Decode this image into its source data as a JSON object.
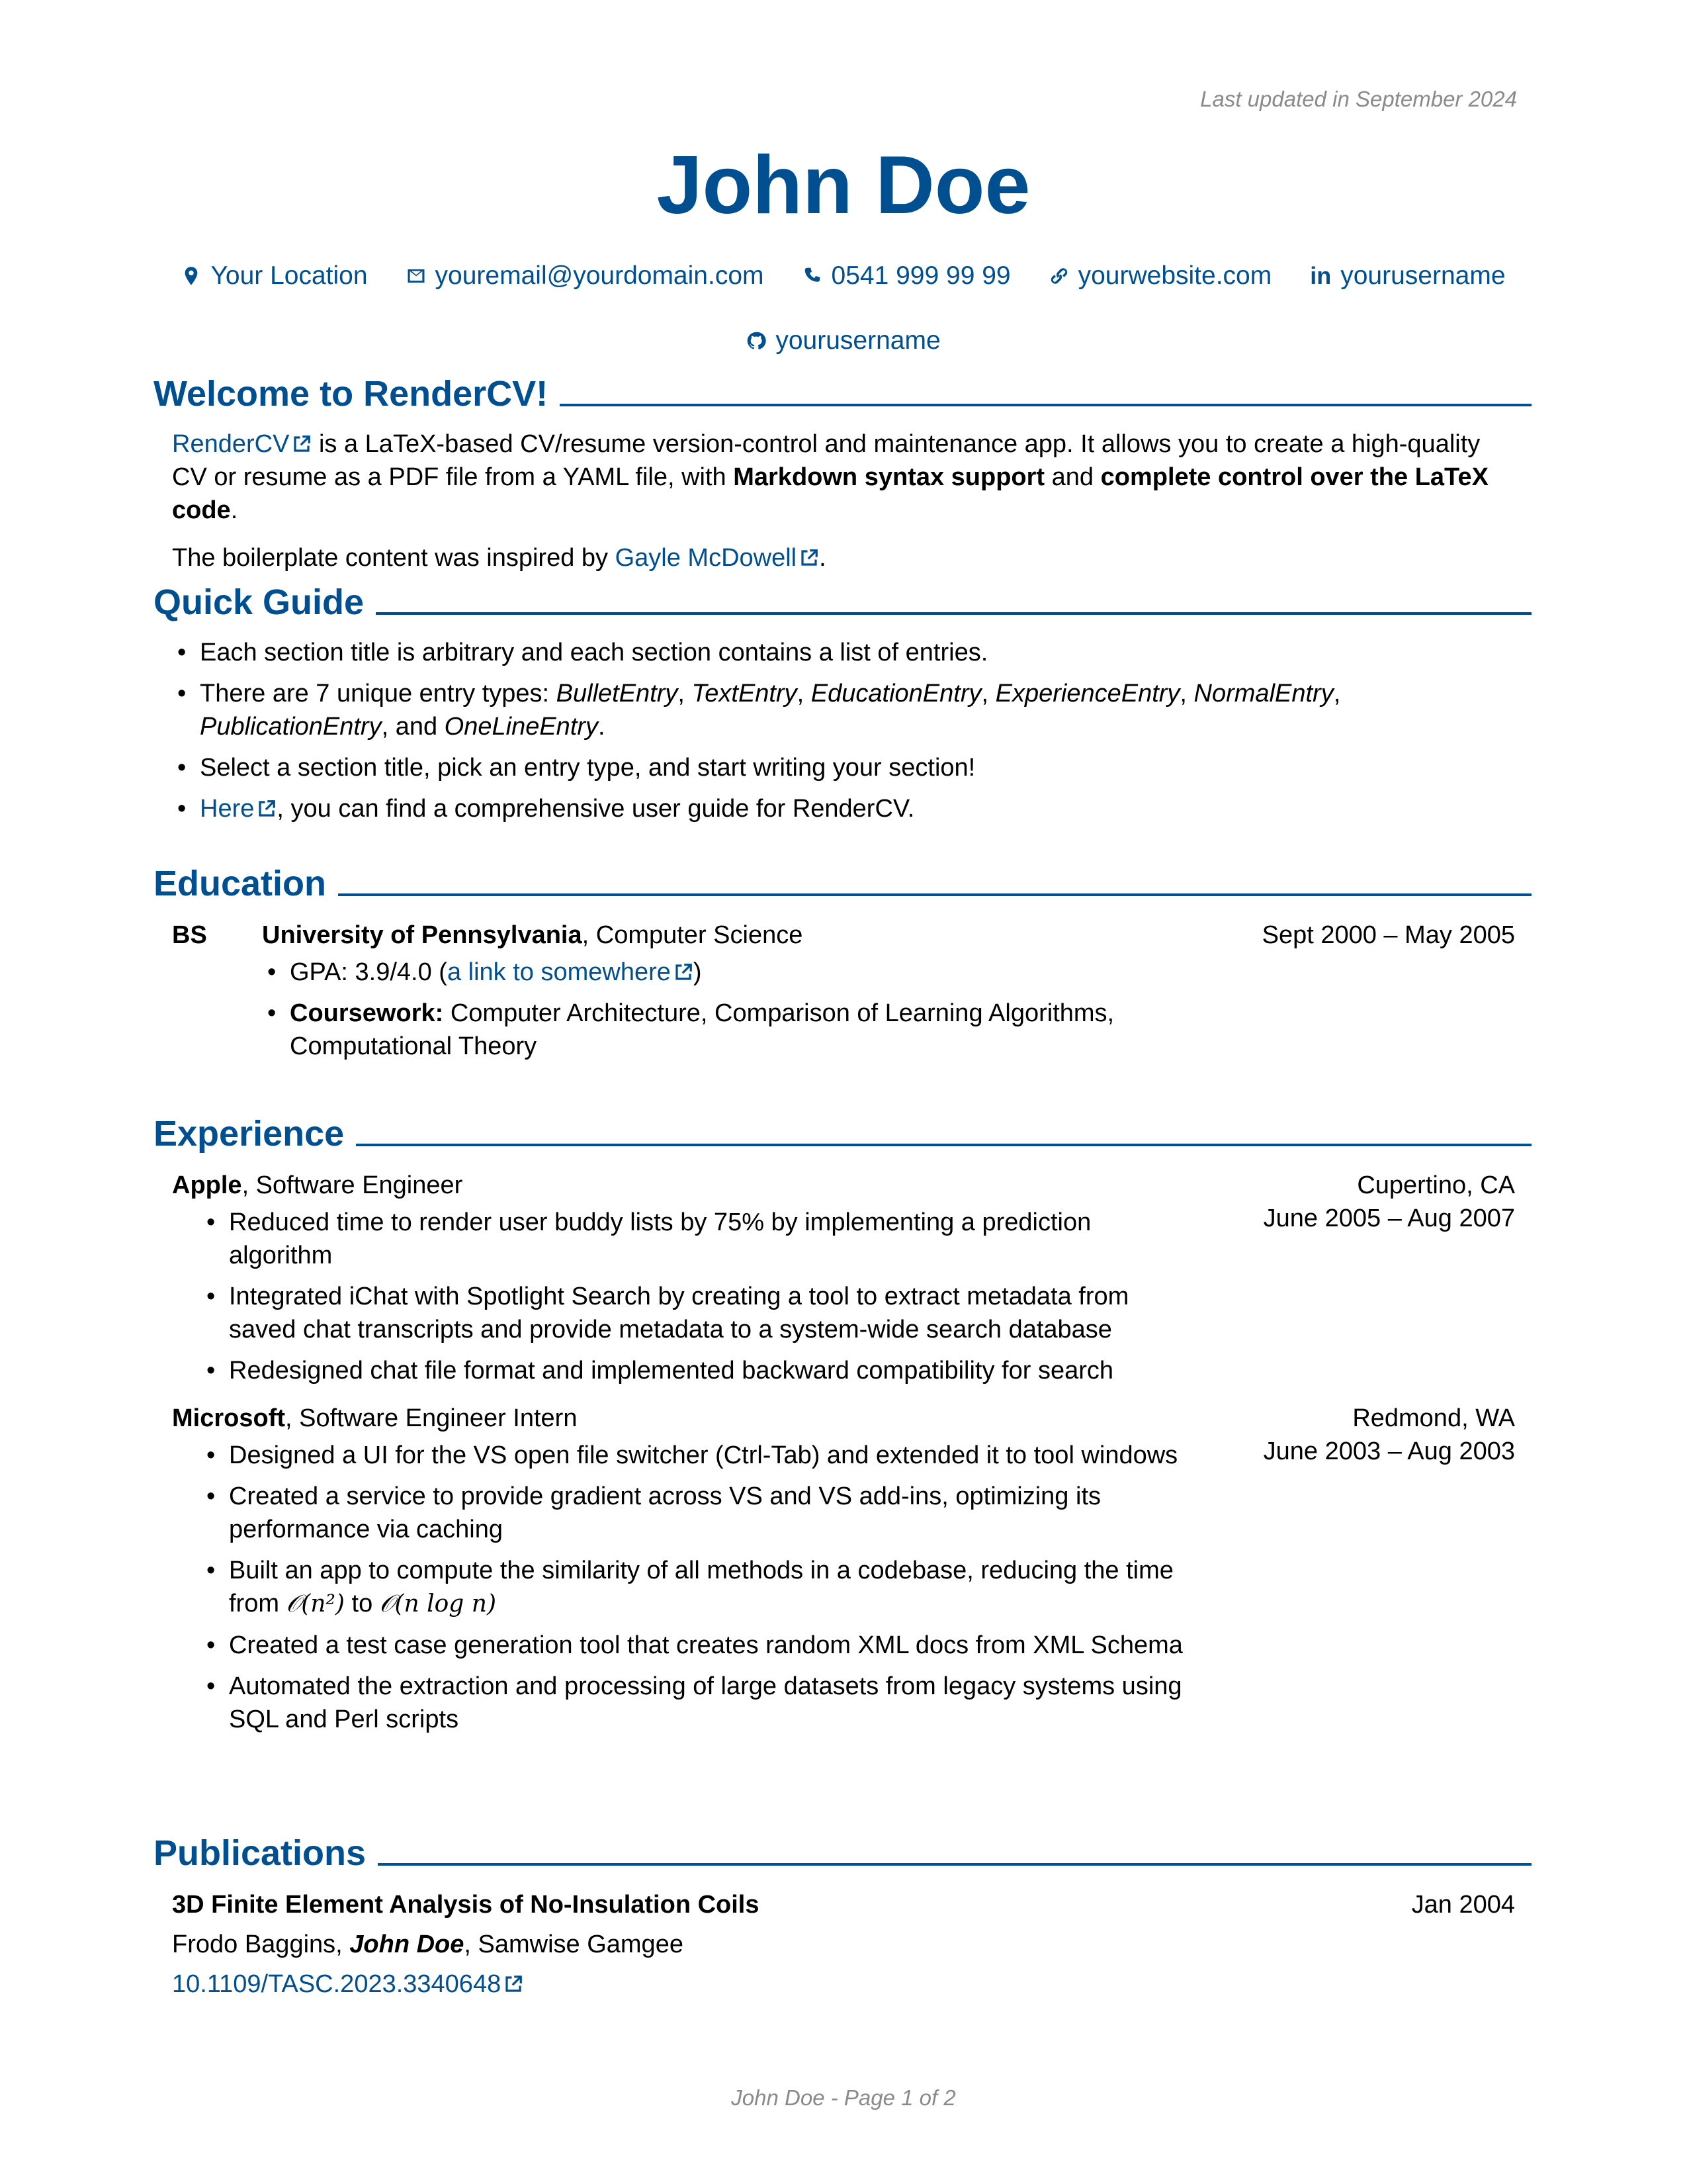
{
  "header": {
    "last_updated": "Last updated in September 2024",
    "name": "John Doe",
    "contacts": [
      {
        "icon": "location-pin-icon",
        "label": "Your Location"
      },
      {
        "icon": "envelope-icon",
        "label": "youremail@yourdomain.com"
      },
      {
        "icon": "phone-icon",
        "label": "0541 999 99 99"
      },
      {
        "icon": "link-icon",
        "label": "yourwebsite.com"
      },
      {
        "icon": "linkedin-icon",
        "label": "yourusername"
      },
      {
        "icon": "github-icon",
        "label": "yourusername"
      }
    ]
  },
  "welcome": {
    "title": "Welcome to RenderCV!",
    "p1_link": "RenderCV",
    "p1_text1": " is a LaTeX-based CV/resume version-control and maintenance app. It allows you to create a high-quality CV or resume as a PDF file from a YAML file, with ",
    "p1_bold1": "Markdown syntax support",
    "p1_text2": " and ",
    "p1_bold2": "complete control over the LaTeX code",
    "p1_text3": ".",
    "p2_text": "The boilerplate content was inspired by ",
    "p2_link": "Gayle McDowell",
    "p2_end": "."
  },
  "quick_guide": {
    "title": "Quick Guide",
    "b1": "Each section title is arbitrary and each section contains a list of entries.",
    "b2_pre": "There are 7 unique entry types: ",
    "b2_types": [
      "BulletEntry",
      "TextEntry",
      "EducationEntry",
      "ExperienceEntry",
      "NormalEntry",
      "PublicationEntry",
      "OneLineEntry"
    ],
    "b2_sep": ", ",
    "b2_and": ", and ",
    "b2_end": ".",
    "b3": "Select a section title, pick an entry type, and start writing your section!",
    "b4_link": "Here",
    "b4_text": ", you can find a comprehensive user guide for RenderCV."
  },
  "education": {
    "title": "Education",
    "degree": "BS",
    "institution": "University of Pennsylvania",
    "area": ", Computer Science",
    "dates": "Sept 2000 – May 2005",
    "gpa_text": "GPA: 3.9/4.0 (",
    "gpa_link": "a link to somewhere",
    "gpa_end": ")",
    "coursework_label": "Coursework:",
    "coursework_text": " Computer Architecture, Comparison of Learning Algorithms, Computational Theory"
  },
  "experience": {
    "title": "Experience",
    "jobs": [
      {
        "company": "Apple",
        "position": ", Software Engineer",
        "location": "Cupertino, CA",
        "dates": "June 2005 – Aug 2007",
        "highlights": [
          "Reduced time to render user buddy lists by 75% by implementing a prediction algorithm",
          "Integrated iChat with Spotlight Search by creating a tool to extract metadata from saved chat transcripts and provide metadata to a system-wide search database",
          "Redesigned chat file format and implemented backward compatibility for search"
        ]
      },
      {
        "company": "Microsoft",
        "position": ", Software Engineer Intern",
        "location": "Redmond, WA",
        "dates": "June 2003 – Aug 2003",
        "highlights": [
          "Designed a UI for the VS open file switcher (Ctrl-Tab) and extended it to tool windows",
          "Created a service to provide gradient across VS and VS add-ins, optimizing its performance via caching",
          "Built an app to compute the similarity of all methods in a codebase, reducing the time from ",
          "Created a test case generation tool that creates random XML docs from XML Schema",
          "Automated the extraction and processing of large datasets from legacy systems using SQL and Perl scripts"
        ],
        "math_1": "𝒪(n²)",
        "math_mid": " to ",
        "math_2": "𝒪(n log n)"
      }
    ]
  },
  "publications": {
    "title": "Publications",
    "pub_title": "3D Finite Element Analysis of No-Insulation Coils",
    "author1": "Frodo Baggins, ",
    "author_self": "John Doe",
    "author3": ", Samwise Gamgee",
    "doi": "10.1109/TASC.2023.3340648",
    "date": "Jan 2004"
  },
  "footer": "John Doe - Page 1 of 2",
  "colors": {
    "accent": "#004f90",
    "muted": "#8a8a8a",
    "text": "#000000"
  }
}
